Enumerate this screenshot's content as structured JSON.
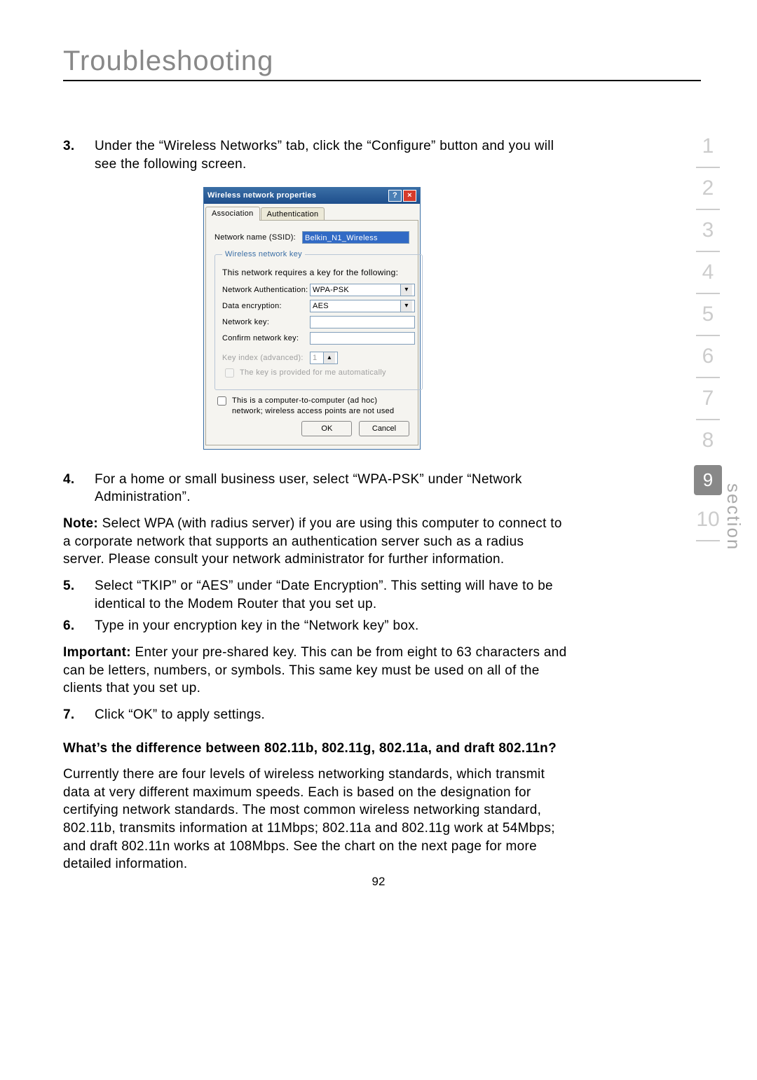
{
  "page": {
    "title": "Troubleshooting",
    "number": "92"
  },
  "sidebar": {
    "label": "section",
    "items": [
      "1",
      "2",
      "3",
      "4",
      "5",
      "6",
      "7",
      "8",
      "9",
      "10"
    ],
    "active_index": 8
  },
  "steps": {
    "s3": {
      "num": "3.",
      "text": "Under the “Wireless Networks” tab, click the “Configure” button and you will see the following screen."
    },
    "s4": {
      "num": "4.",
      "text": "For a home or small business user, select “WPA-PSK” under “Network Administration”."
    },
    "note": {
      "label": "Note:",
      "text": " Select WPA (with radius server) if you are using this computer to connect to a corporate network that supports an authentication server such as a radius server. Please consult your network administrator for further information."
    },
    "s5": {
      "num": "5.",
      "text": "Select “TKIP” or “AES” under “Date Encryption”. This setting will have to be identical to the Modem Router that you set up."
    },
    "s6": {
      "num": "6.",
      "text": "Type in your encryption key in the “Network key” box."
    },
    "important": {
      "label": "Important:",
      "text": " Enter your pre-shared key. This can be from eight to 63 characters and can be letters, numbers, or symbols. This same key must be used on all of the clients that you set up."
    },
    "s7": {
      "num": "7.",
      "text": "Click “OK” to apply settings."
    }
  },
  "question": {
    "heading": "What’s the difference between 802.11b, 802.11g, 802.11a, and draft 802.11n?",
    "body": "Currently there are four levels of wireless networking standards, which transmit data at very different maximum speeds. Each is based on the designation for certifying network standards. The most common wireless networking standard, 802.11b, transmits information at 11Mbps; 802.11a and 802.11g work at 54Mbps; and draft 802.11n works at 108Mbps. See the chart on the next page for more detailed information."
  },
  "dialog": {
    "title": "Wireless network properties",
    "tabs": [
      "Association",
      "Authentication"
    ],
    "ssid_label": "Network name (SSID):",
    "ssid_value": "Belkin_N1_Wireless",
    "fieldset_legend": "Wireless network key",
    "fieldset_desc": "This network requires a key for the following:",
    "auth_label": "Network Authentication:",
    "auth_value": "WPA-PSK",
    "enc_label": "Data encryption:",
    "enc_value": "AES",
    "key_label": "Network key:",
    "confirm_label": "Confirm network key:",
    "keyindex_label": "Key index (advanced):",
    "keyindex_value": "1",
    "auto_label": "The key is provided for me automatically",
    "adhoc_label": "This is a computer-to-computer (ad hoc) network; wireless access points are not used",
    "ok": "OK",
    "cancel": "Cancel"
  }
}
